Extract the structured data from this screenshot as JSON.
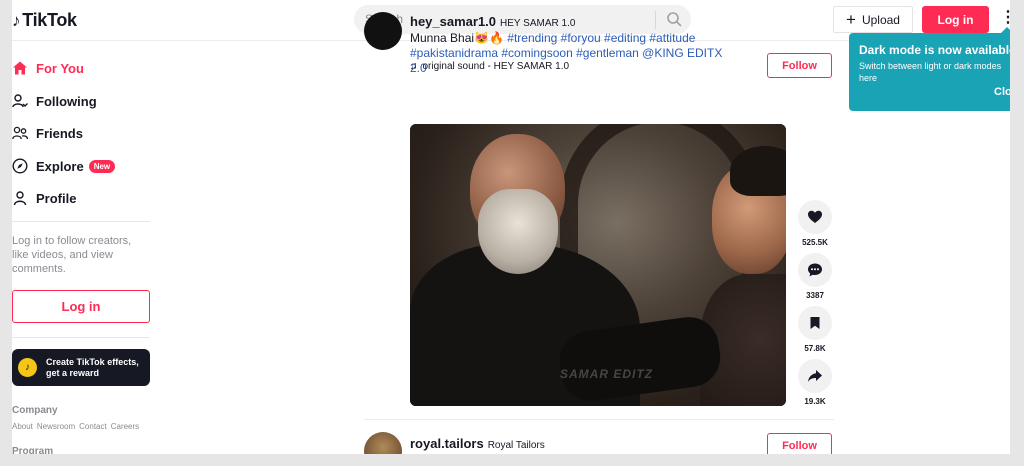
{
  "header": {
    "logo_text": "TikTok",
    "search_placeholder": "Search",
    "upload_label": "Upload",
    "login_label": "Log in"
  },
  "sidebar": {
    "nav": [
      {
        "label": "For You",
        "icon": "home-icon",
        "active": true
      },
      {
        "label": "Following",
        "icon": "following-icon"
      },
      {
        "label": "Friends",
        "icon": "friends-icon"
      },
      {
        "label": "Explore",
        "icon": "compass-icon",
        "badge": "New"
      },
      {
        "label": "Profile",
        "icon": "profile-icon"
      }
    ],
    "login_prompt": "Log in to follow creators, like videos, and view comments.",
    "login_button": "Log in",
    "effects_text": "Create TikTok effects, get a reward",
    "footer_company_heading": "Company",
    "footer_company_links": [
      "About",
      "Newsroom",
      "Contact",
      "Careers"
    ],
    "footer_program_heading": "Program"
  },
  "feed": {
    "posts": [
      {
        "username": "hey_samar1.0",
        "nickname": "HEY SAMAR 1.0",
        "caption_prefix": "Munna Bhai😻🔥",
        "hashtags_line1": "#trending #foryou #editing #attitude",
        "hashtags_line2": "#pakistanidrama #comingsoon #gentleman @KING EDITX 2.0",
        "sound": "original sound - HEY SAMAR 1.0",
        "follow_label": "Follow",
        "video_watermark": "SAMAR EDITZ",
        "likes": "525.5K",
        "comments": "3387",
        "saves": "57.8K",
        "shares": "19.3K"
      },
      {
        "username": "royal.tailors",
        "nickname": "Royal Tailors",
        "follow_label": "Follow"
      }
    ]
  },
  "toast": {
    "title": "Dark mode is now available",
    "body": "Switch between light or dark modes here",
    "close_label": "Close"
  },
  "colors": {
    "brand": "#fe2c55",
    "toast_bg": "#1aa2b5",
    "hashtag": "#2b5db9"
  }
}
